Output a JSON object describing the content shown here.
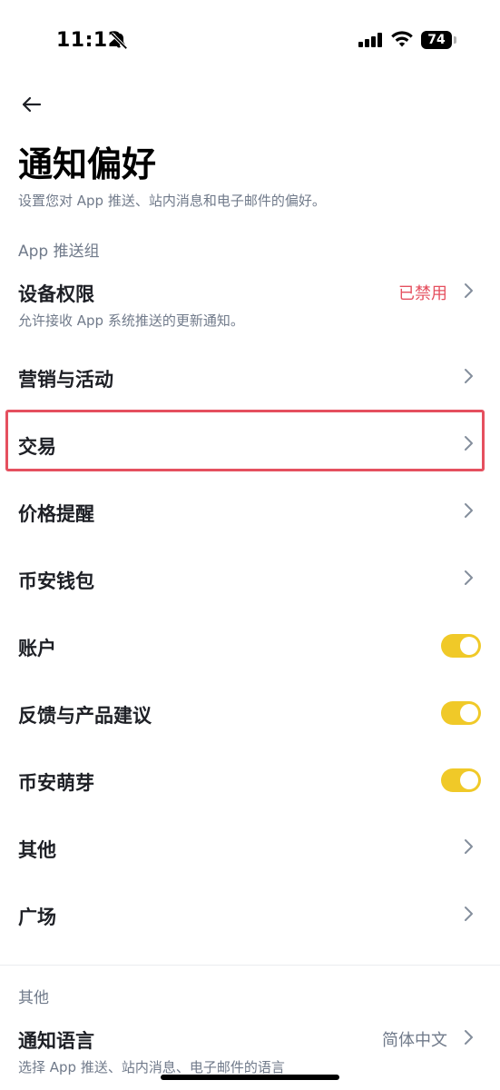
{
  "status": {
    "time": "11:12",
    "battery": "74"
  },
  "page": {
    "title": "通知偏好",
    "subtitle": "设置您对 App 推送、站内消息和电子邮件的偏好。"
  },
  "sections": {
    "app_push": "App 推送组",
    "other": "其他"
  },
  "rows": {
    "device_permission": {
      "title": "设备权限",
      "desc": "允许接收 App 系统推送的更新通知。",
      "value": "已禁用",
      "value_color": "#e5505f"
    },
    "marketing": {
      "title": "营销与活动"
    },
    "trading": {
      "title": "交易"
    },
    "price_alert": {
      "title": "价格提醒"
    },
    "wallet": {
      "title": "币安钱包"
    },
    "account": {
      "title": "账户",
      "enabled": true
    },
    "feedback": {
      "title": "反馈与产品建议",
      "enabled": true
    },
    "sprout": {
      "title": "币安萌芽",
      "enabled": true
    },
    "others": {
      "title": "其他"
    },
    "square": {
      "title": "广场"
    },
    "language": {
      "title": "通知语言",
      "desc": "选择 App 推送、站内消息、电子邮件的语言",
      "value": "简体中文"
    }
  },
  "colors": {
    "toggle_on": "#f0c928",
    "highlight": "#e5505f"
  },
  "icons": [
    "bell-slash-icon",
    "signal-icon",
    "wifi-icon",
    "battery-icon",
    "back-arrow-icon",
    "chevron-right-icon"
  ]
}
